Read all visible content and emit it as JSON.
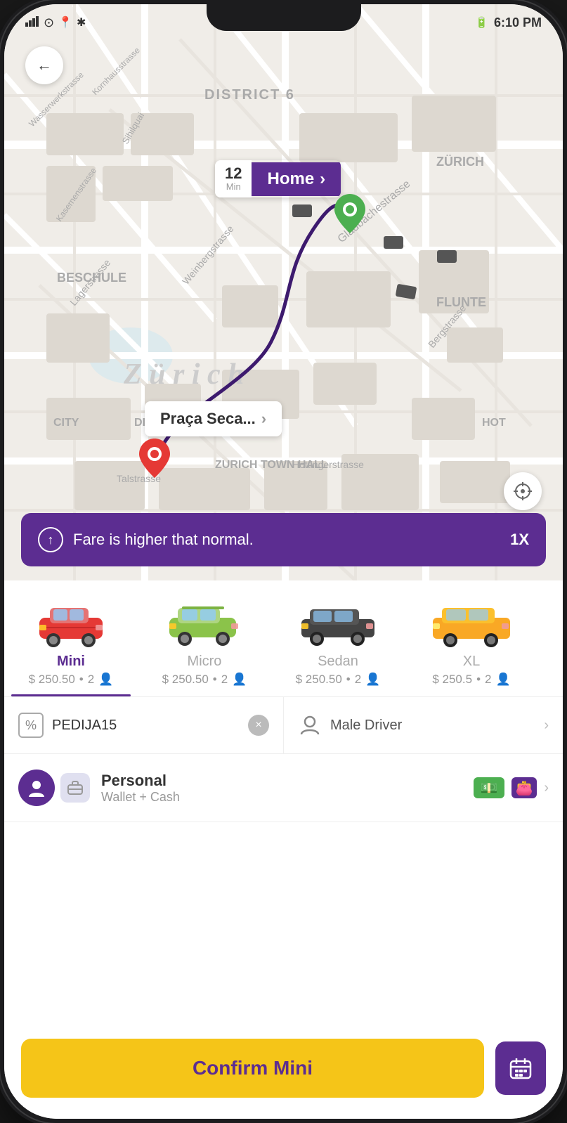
{
  "status_bar": {
    "time": "6:10 PM",
    "signal_icon": "signal",
    "wifi_icon": "wifi",
    "location_icon": "location",
    "bluetooth_icon": "bluetooth",
    "battery_icon": "battery"
  },
  "map": {
    "city_label": "Zürich",
    "district_label": "DISTRICT 6",
    "zuriche_label": "ZÜRICH",
    "flunte_label": "FLUNTE",
    "beschule_label": "BESCHULE",
    "city_label2": "CITY",
    "zurich_town_hall": "ZURICH TOWN HALL",
    "hot_label": "HOT"
  },
  "navigation": {
    "back_arrow": "←",
    "home_minutes": "12",
    "home_min_label": "Min",
    "home_destination": "Home",
    "praca_label": "Praça Seca...",
    "chevron": "›"
  },
  "fare_banner": {
    "text": "Fare is higher that normal.",
    "multiplier": "1X",
    "up_arrow": "↑"
  },
  "cars": [
    {
      "name": "Mini",
      "price": "$ 250.50",
      "capacity": "2",
      "active": true
    },
    {
      "name": "Micro",
      "price": "$ 250.50",
      "capacity": "2",
      "active": false
    },
    {
      "name": "Sedan",
      "price": "$ 250.50",
      "capacity": "2",
      "active": false
    },
    {
      "name": "XL",
      "price": "$ 250.5",
      "capacity": "2",
      "active": false
    }
  ],
  "promo": {
    "icon": "%",
    "code": "PEDIJA15",
    "clear_icon": "×"
  },
  "driver": {
    "label": "Male Driver",
    "chevron": "›"
  },
  "payment": {
    "name": "Personal",
    "method": "Wallet + Cash",
    "cash_emoji": "💵",
    "wallet_emoji": "👛",
    "chevron": "›"
  },
  "confirm": {
    "label": "Confirm Mini",
    "schedule_icon": "📅"
  },
  "colors": {
    "purple": "#5c2d91",
    "yellow": "#f5c518",
    "green": "#4caf50"
  }
}
